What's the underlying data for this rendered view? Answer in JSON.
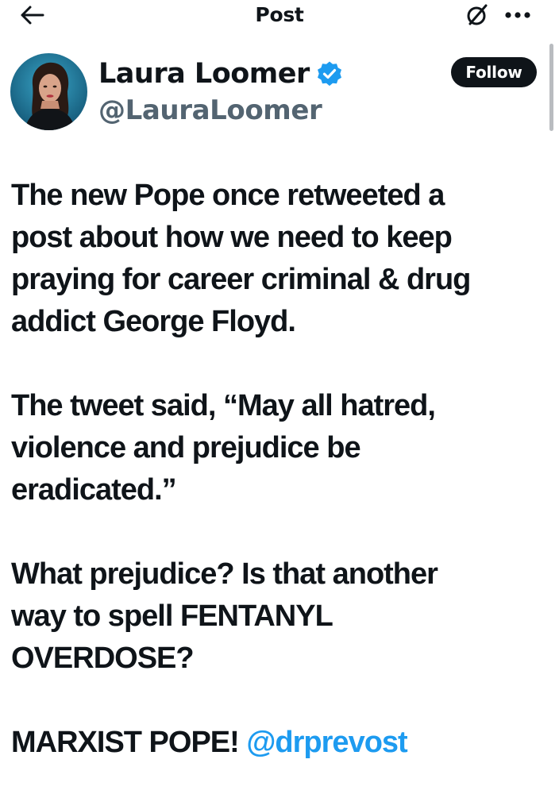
{
  "header": {
    "title": "Post",
    "back_icon": "arrow-left-icon",
    "grok_icon": "grok-icon",
    "more_icon": "more-horizontal-icon"
  },
  "author": {
    "name": "Laura Loomer",
    "handle": "@LauraLoomer",
    "verified": true,
    "verified_color": "#1d9bf0",
    "follow_label": "Follow"
  },
  "post": {
    "paragraphs": [
      {
        "lines": [
          "The new Pope once retweeted a",
          "post about how we need to keep",
          "praying for career criminal & drug",
          "addict George Floyd."
        ]
      },
      {
        "lines": [
          "The tweet said, “May all hatred,",
          "violence and prejudice be",
          "eradicated.”"
        ]
      },
      {
        "lines": [
          "What prejudice? Is that another",
          "way to spell FENTANYL",
          "OVERDOSE?"
        ]
      }
    ],
    "last_line_text": "MARXIST POPE! ",
    "mention": "@drprevost"
  },
  "colors": {
    "text": "#0f1419",
    "secondary": "#536471",
    "accent": "#1d9bf0",
    "follow_bg": "#0f1419"
  }
}
